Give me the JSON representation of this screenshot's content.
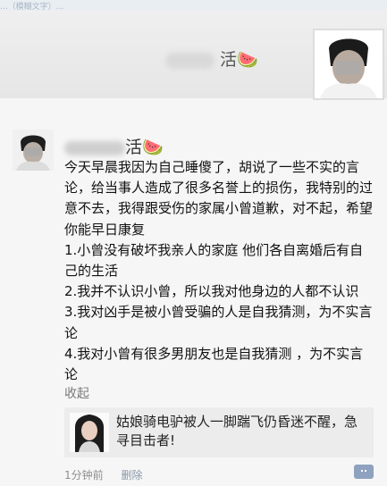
{
  "header": {
    "top_strip_text": "...（模糊文字）...",
    "profile_name": "活",
    "profile_emoji": "🍉"
  },
  "post": {
    "poster_name": "活",
    "poster_emoji": "🍉",
    "paragraphs": [
      "今天早晨我因为自己睡傻了，胡说了一些不实的言论，给当事人造成了很多名誉上的损伤，我特别的过意不去，我得跟受伤的家属小曾道歉，对不起，希望你能早日康复",
      "1.小曾没有破坏我亲人的家庭 他们各自离婚后有自己的生活",
      "2.我并不认识小曾，所以我对他身边的人都不认识",
      "3.我对凶手是被小曾受骗的人是自我猜测，为不实言论",
      "4.我对小曾有很多男朋友也是自我猜测 ，为不实言论"
    ],
    "collapse_label": "收起",
    "shared_title": "姑娘骑电驴被人一脚踹飞仍昏迷不醒，急寻目击者!",
    "time": "1分钟前",
    "delete_label": "删除"
  },
  "icons": {
    "comment": "comment-icon",
    "avatar": "avatar-icon",
    "share_thumb": "image-thumbnail-icon"
  }
}
